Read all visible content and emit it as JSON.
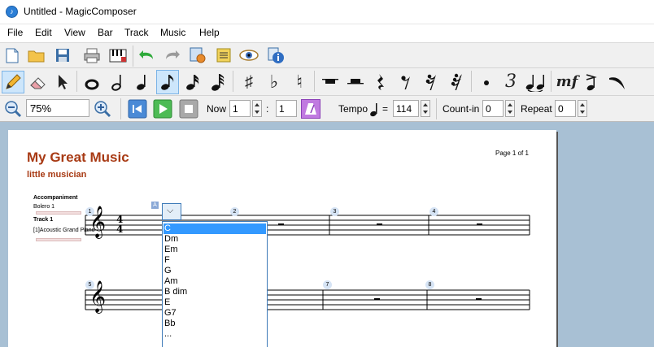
{
  "window": {
    "title": "Untitled - MagicComposer",
    "app_icon": "music-note-icon"
  },
  "menu": [
    "File",
    "Edit",
    "View",
    "Bar",
    "Track",
    "Music",
    "Help"
  ],
  "toolbar": {
    "file_tools": [
      "new-file-icon",
      "open-folder-icon",
      "save-disk-icon",
      "print-icon",
      "keyboard-icon",
      "undo-icon",
      "redo-icon",
      "music-settings-icon",
      "track-settings-icon",
      "preview-eye-icon",
      "info-icon"
    ],
    "note_tools": [
      "pencil-icon",
      "eraser-icon",
      "pointer-icon",
      "whole-note-icon",
      "half-note-icon",
      "quarter-note-icon",
      "eighth-note-icon",
      "sixteenth-note-icon",
      "thirty-second-note-icon",
      "sharp-icon",
      "flat-icon",
      "natural-icon",
      "whole-rest-icon",
      "half-rest-icon",
      "quarter-rest-icon",
      "eighth-rest-icon",
      "sixteenth-rest-icon",
      "thirty-second-rest-icon",
      "dot-icon",
      "triplet-icon",
      "tie-icon",
      "dynamics-icon",
      "accent-icon",
      "slur-icon"
    ],
    "flat_label": "♭",
    "sharp_label": "♯",
    "natural_label": "♮",
    "triplet_label": "3",
    "dynamics_label": "mf"
  },
  "transport": {
    "zoom": "75%",
    "now_label": "Now",
    "now_bar": "1",
    "now_sep": ":",
    "now_beat": "1",
    "tempo_label": "Tempo",
    "tempo_eq": "=",
    "tempo_value": "114",
    "countin_label": "Count-in",
    "countin_value": "0",
    "repeat_label": "Repeat",
    "repeat_value": "0"
  },
  "score": {
    "title": "My Great Music",
    "subtitle": "little musician",
    "page": "Page 1 of 1",
    "tracks": [
      {
        "name": "Accompaniment",
        "detail": "Bolero 1"
      },
      {
        "name": "Track 1",
        "detail": "[1]Acoustic Grand Piano"
      }
    ],
    "time_signature": [
      "4",
      "4"
    ],
    "bar_numbers_row1": [
      "1",
      "2",
      "3",
      "4"
    ],
    "bar_numbers_row2": [
      "5",
      "6",
      "7",
      "8"
    ],
    "chord_marker": "A"
  },
  "chord_dropdown": {
    "selected": "C",
    "options": [
      "C",
      "Dm",
      "Em",
      "F",
      "G",
      "Am",
      "B dim",
      "E",
      "G7",
      "Bb",
      "..."
    ]
  },
  "colors": {
    "accent_title": "#a83a14",
    "selection": "#3399ff",
    "workspace": "#a8c0d4"
  }
}
